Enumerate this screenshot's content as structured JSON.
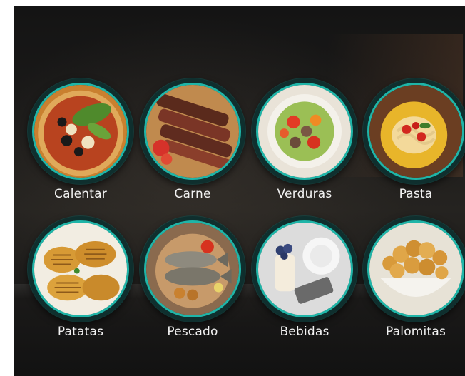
{
  "menu": {
    "items": [
      {
        "label": "Calentar",
        "icon": "pizza-icon"
      },
      {
        "label": "Carne",
        "icon": "steak-icon"
      },
      {
        "label": "Verduras",
        "icon": "vegetables-icon"
      },
      {
        "label": "Pasta",
        "icon": "pasta-icon"
      },
      {
        "label": "Patatas",
        "icon": "potatoes-icon"
      },
      {
        "label": "Pescado",
        "icon": "fish-icon"
      },
      {
        "label": "Bebidas",
        "icon": "drinks-icon"
      },
      {
        "label": "Palomitas",
        "icon": "popcorn-icon"
      }
    ]
  },
  "colors": {
    "ring_accent": "#1fb5a8",
    "ring_base": "#0f2f2e",
    "label_text": "#f2f2f2"
  }
}
